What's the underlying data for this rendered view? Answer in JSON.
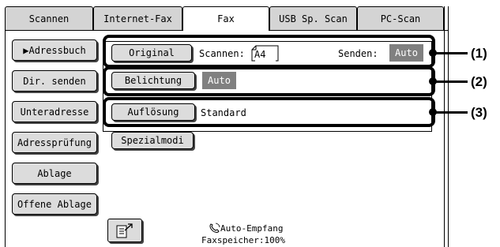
{
  "tabs": [
    {
      "label": "Scannen"
    },
    {
      "label": "Internet-Fax"
    },
    {
      "label": "Fax"
    },
    {
      "label": "USB Sp. Scan"
    },
    {
      "label": "PC-Scan"
    }
  ],
  "sidebar": {
    "adressbuch": "▶Adressbuch",
    "dir_senden": "Dir. senden",
    "unteradresse": "Unteradresse",
    "adresspruefung": "Adressprüfung",
    "ablage": "Ablage",
    "offene_ablage": "Offene Ablage"
  },
  "settings": {
    "original": {
      "button": "Original",
      "scan_label": "Scannen:",
      "scan_size": "A4",
      "send_label": "Senden:",
      "send_value": "Auto"
    },
    "belichtung": {
      "button": "Belichtung",
      "value": "Auto"
    },
    "aufloesung": {
      "button": "Auflösung",
      "value": "Standard"
    },
    "spezialmodi": {
      "button": "Spezialmodi"
    }
  },
  "status": {
    "receive_mode": "Auto-Empfang",
    "memory": "Faxspeicher:100%"
  },
  "callouts": [
    "(1)",
    "(2)",
    "(3)"
  ],
  "icons": {
    "phone": "phone-icon",
    "send_doc": "document-send-icon"
  },
  "colors": {
    "badge": "#808080",
    "tab_inactive": "#d4d4d4",
    "button": "#dcdcdc"
  }
}
